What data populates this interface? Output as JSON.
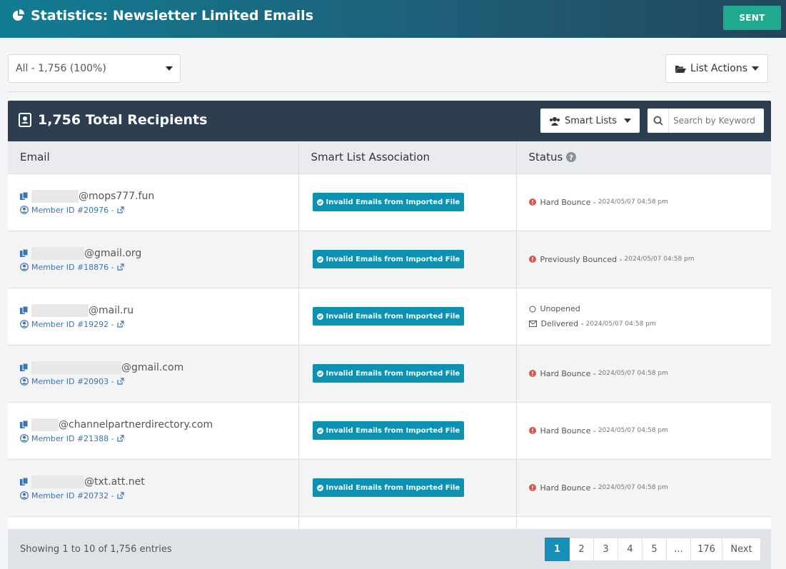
{
  "header": {
    "title": "Statistics: Newsletter Limited Emails",
    "sent_label": "SENT"
  },
  "filter": {
    "selected": "All - 1,756 (100%)"
  },
  "list_actions_label": "List Actions",
  "panel": {
    "title": "1,756 Total Recipients",
    "smart_lists_label": "Smart Lists",
    "search_placeholder": "Search by Keyword"
  },
  "table": {
    "headers": [
      "Email",
      "Smart List Association",
      "Status"
    ],
    "rows": [
      {
        "domain": "@mops777.fun",
        "member": "Member ID #20976 -",
        "badge": "Invalid Emails from Imported File",
        "status": "Hard Bounce -",
        "ts": "2024/05/07 04:58 pm"
      },
      {
        "domain": "@gmail.org",
        "member": "Member ID #18876 -",
        "badge": "Invalid Emails from Imported File",
        "status": "Previously Bounced -",
        "ts": "2024/05/07 04:58 pm"
      },
      {
        "domain": "@mail.ru",
        "member": "Member ID #19292 -",
        "badge": "Invalid Emails from Imported File",
        "status": "Unopened",
        "status2": "Delivered -",
        "ts": "2024/05/07 04:58 pm"
      },
      {
        "domain": "@gmail.com",
        "member": "Member ID #20903 -",
        "badge": "Invalid Emails from Imported File",
        "status": "Hard Bounce -",
        "ts": "2024/05/07 04:58 pm"
      },
      {
        "domain": "@channelpartnerdirectory.com",
        "member": "Member ID #21388 -",
        "badge": "Invalid Emails from Imported File",
        "status": "Hard Bounce -",
        "ts": "2024/05/07 04:58 pm"
      },
      {
        "domain": "@txt.att.net",
        "member": "Member ID #20732 -",
        "badge": "Invalid Emails from Imported File",
        "status": "Hard Bounce -",
        "ts": "2024/05/07 04:58 pm"
      }
    ]
  },
  "footer": {
    "info": "Showing 1 to 10 of 1,756 entries",
    "pages": [
      "1",
      "2",
      "3",
      "4",
      "5",
      "...",
      "176",
      "Next"
    ]
  }
}
